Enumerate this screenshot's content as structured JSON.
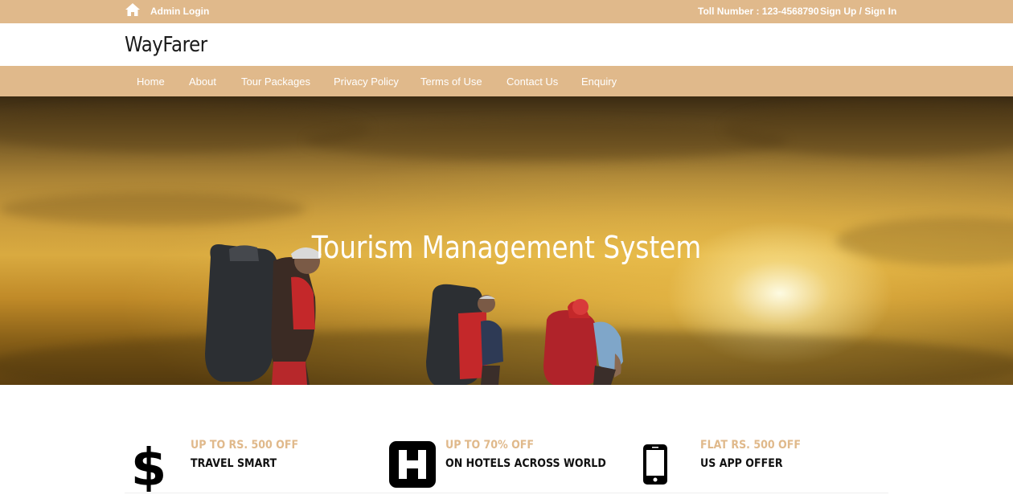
{
  "topbar": {
    "admin_login": "Admin Login",
    "toll_number": "Toll Number : 123-4568790",
    "signup_signin": "Sign Up / Sign In"
  },
  "brand": {
    "logo": "WayFarer"
  },
  "nav": {
    "items": [
      {
        "label": "Home"
      },
      {
        "label": "About"
      },
      {
        "label": "Tour Packages"
      },
      {
        "label": "Privacy Policy"
      },
      {
        "label": "Terms of Use"
      },
      {
        "label": "Contact Us"
      },
      {
        "label": "Enquiry"
      }
    ]
  },
  "hero": {
    "title": "Tourism Management System"
  },
  "features": [
    {
      "icon": "dollar-icon",
      "offer": "UP TO RS. 500 OFF",
      "desc": "TRAVEL SMART"
    },
    {
      "icon": "hospital-h-icon",
      "offer": "UP TO 70% OFF",
      "desc": "ON HOTELS ACROSS WORLD"
    },
    {
      "icon": "mobile-phone-icon",
      "offer": "FLAT RS. 500 OFF",
      "desc": "US APP OFFER"
    }
  ],
  "colors": {
    "accent": "#e0b98b",
    "text_dark": "#111111",
    "white": "#ffffff"
  }
}
